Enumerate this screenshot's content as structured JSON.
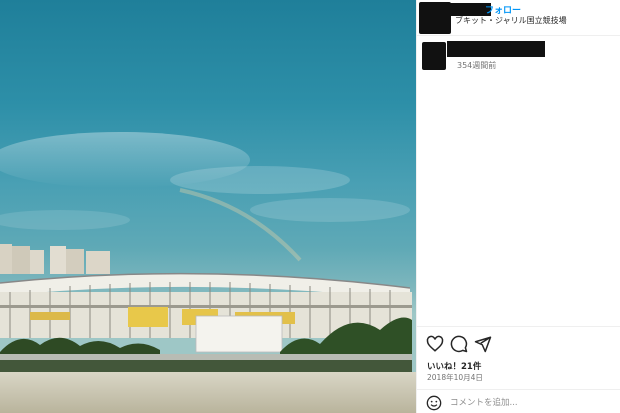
{
  "header": {
    "follow_label": "フォロー",
    "location": "ブキット・ジャリル国立競技場"
  },
  "caption": {
    "time_ago": "354週間前"
  },
  "actions": {
    "likes_text": "いいね！21件",
    "date_text": "2018年10月4日"
  },
  "comment": {
    "placeholder": "コメントを追加..."
  },
  "icons": [
    "heart-icon",
    "comment-icon",
    "share-icon",
    "emoji-icon"
  ],
  "colors": {
    "link": "#0095f6",
    "muted": "#737373",
    "redaction": "#111111"
  }
}
